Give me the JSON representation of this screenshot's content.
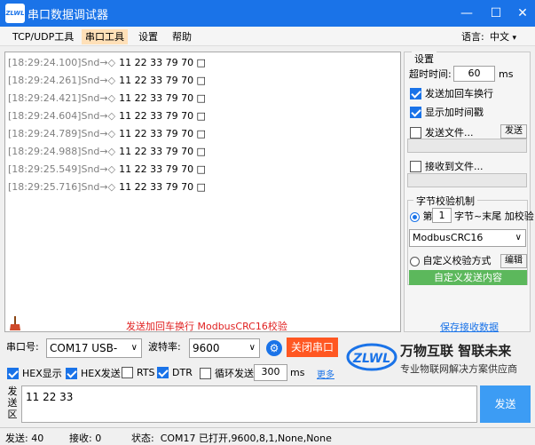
{
  "window": {
    "title": "串口数据调试器",
    "logo_text": "ZLWL",
    "accent": "#1a73e8"
  },
  "menu": {
    "items": [
      "TCP/UDP工具",
      "串口工具",
      "设置",
      "帮助"
    ],
    "active_index": 1,
    "language_label": "语言:",
    "language_value": "中文"
  },
  "receive": {
    "lines": [
      {
        "time": "[18:29:24.100]Snd→◇",
        "data": "11 22 33 79 70 □"
      },
      {
        "time": "[18:29:24.261]Snd→◇",
        "data": "11 22 33 79 70 □"
      },
      {
        "time": "[18:29:24.421]Snd→◇",
        "data": "11 22 33 79 70 □"
      },
      {
        "time": "[18:29:24.604]Snd→◇",
        "data": "11 22 33 79 70 □"
      },
      {
        "time": "[18:29:24.789]Snd→◇",
        "data": "11 22 33 79 70 □"
      },
      {
        "time": "[18:29:24.988]Snd→◇",
        "data": "11 22 33 79 70 □"
      },
      {
        "time": "[18:29:25.549]Snd→◇",
        "data": "11 22 33 79 70 □"
      },
      {
        "time": "[18:29:25.716]Snd→◇",
        "data": "11 22 33 79 70 □"
      }
    ],
    "hint": "发送加回车换行 ModbusCRC16校验"
  },
  "settings": {
    "group_title": "设置",
    "timeout_label": "超时时间:",
    "timeout_value": "60",
    "timeout_unit": "ms",
    "send_crlf_label": "发送加回车换行",
    "show_timestamp_label": "显示加时间戳",
    "send_file_label": "发送文件...",
    "send_file_button": "发送",
    "recv_to_file_label": "接收到文件...",
    "checksum_title": "字节校验机制",
    "checksum_prefix": "第",
    "checksum_start": "1",
    "checksum_suffix": "字节~末尾 加校验",
    "checksum_method": "ModbusCRC16",
    "custom_checksum_label": "自定义校验方式",
    "edit_button": "编辑",
    "custom_send_button": "自定义发送内容",
    "save_receive_link": "保存接收数据"
  },
  "port": {
    "port_label": "串口号:",
    "port_value": "COM17 USB-",
    "baud_label": "波特率:",
    "baud_value": "9600",
    "open_close_button": "关闭串口"
  },
  "options": {
    "hex_display": "HEX显示",
    "hex_send": "HEX发送",
    "rts": "RTS",
    "dtr": "DTR",
    "loop_send": "循环发送",
    "loop_interval": "300",
    "loop_unit": "ms",
    "more": "更多"
  },
  "brand": {
    "logo_text": "ZLWL",
    "slogan": "万物互联 智联未来",
    "subtitle": "专业物联网解决方案供应商"
  },
  "send": {
    "label": "发送区",
    "text": "11 22 33",
    "button": "发送"
  },
  "status": {
    "sent": "发送: 40",
    "received": "接收: 0",
    "state": "状态:  COM17 已打开,9600,8,1,None,None"
  }
}
